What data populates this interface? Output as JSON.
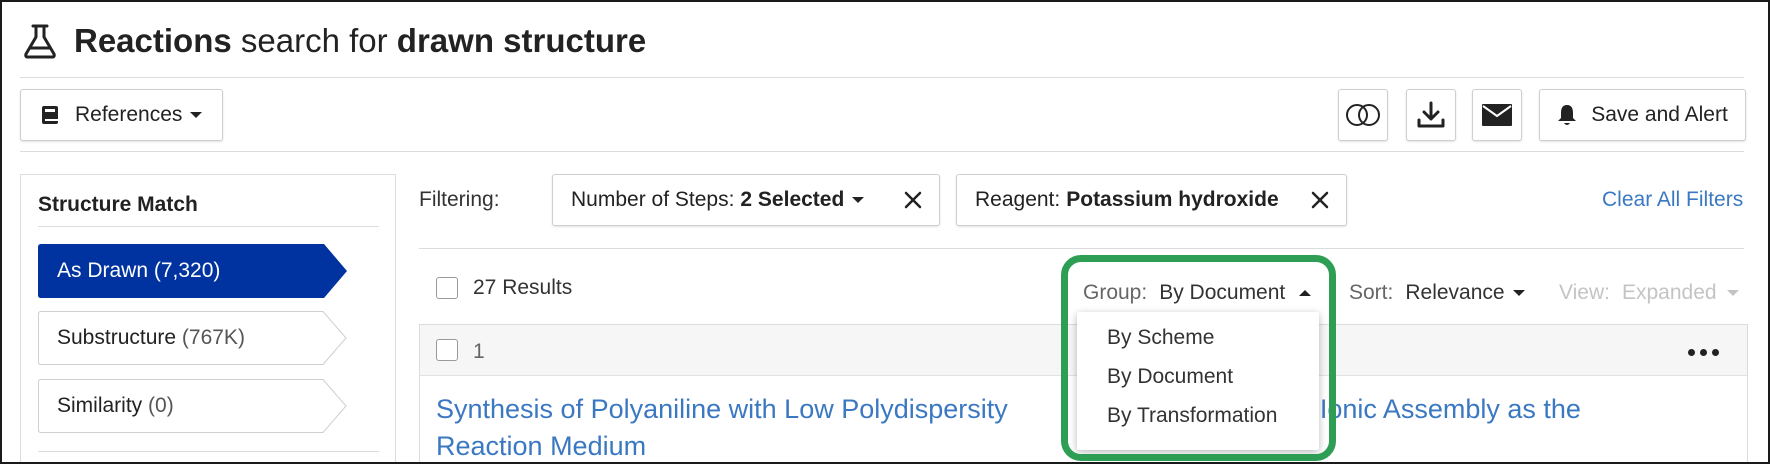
{
  "header": {
    "title_bold_1": "Reactions",
    "title_mid": "search for",
    "title_bold_2": "drawn structure"
  },
  "toolbar": {
    "references_label": "References",
    "save_alert_label": "Save and Alert"
  },
  "left_panel": {
    "title": "Structure Match",
    "tabs": [
      {
        "label": "As Drawn",
        "count": "(7,320)",
        "active": true
      },
      {
        "label": "Substructure",
        "count": "(767K)",
        "active": false
      },
      {
        "label": "Similarity",
        "count": "(0)",
        "active": false
      }
    ]
  },
  "filtering": {
    "label": "Filtering:",
    "chips": [
      {
        "key": "Number of Steps:",
        "value": "2 Selected"
      },
      {
        "key": "Reagent:",
        "value": "Potassium hydroxide"
      }
    ],
    "clear_all": "Clear All Filters"
  },
  "results": {
    "count_label": "27 Results",
    "group": {
      "label": "Group:",
      "value": "By Document"
    },
    "sort": {
      "label": "Sort:",
      "value": "Relevance"
    },
    "view": {
      "label": "View:",
      "value": "Expanded"
    }
  },
  "group_menu": {
    "options": [
      "By Scheme",
      "By Document",
      "By Transformation"
    ]
  },
  "result_card": {
    "number": "1",
    "title_part_1": "Synthesis of Polyaniline with Low Polydispersity",
    "title_part_2": "lecular Ionic Assembly as the",
    "title_part_3": "Reaction Medium"
  },
  "colors": {
    "accent_blue": "#0033a0",
    "link_blue": "#3b78c2",
    "highlight_green": "#2e9e55"
  }
}
